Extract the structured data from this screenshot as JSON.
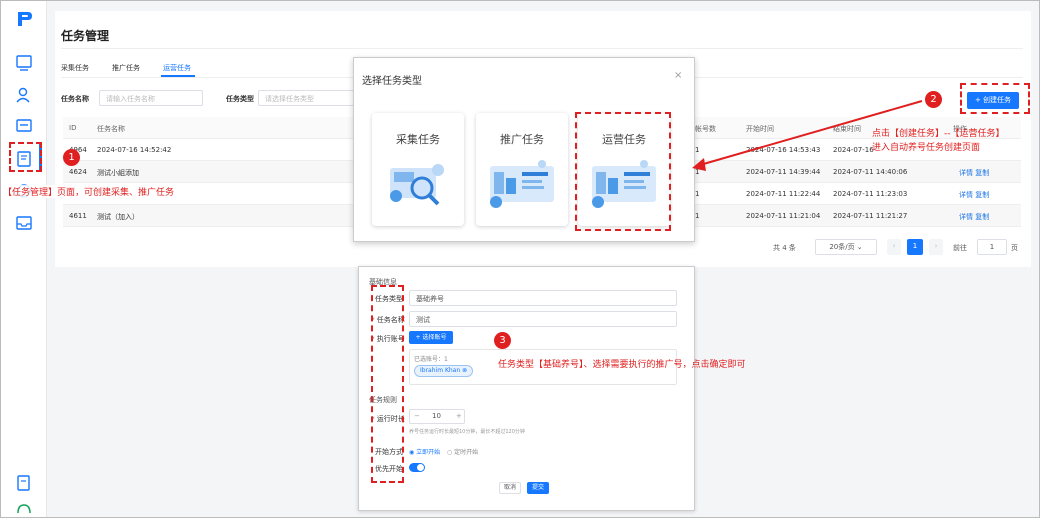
{
  "page": {
    "title": "任务管理"
  },
  "tabs": [
    "采集任务",
    "推广任务",
    "运营任务"
  ],
  "filters": {
    "name_label": "任务名称",
    "name_placeholder": "请输入任务名称",
    "type_label": "任务类型",
    "type_placeholder": "请选择任务类型"
  },
  "create_button": "+ 创建任务",
  "table": {
    "headers": [
      "ID",
      "任务名称",
      "帐号数",
      "开始时间",
      "结束时间",
      "操作"
    ],
    "rows": [
      {
        "id": "4964",
        "name": "2024-07-16 14:52:42",
        "count": "1",
        "start": "2024-07-16 14:53:43",
        "end": "2024-07-16",
        "ops": ""
      },
      {
        "id": "4624",
        "name": "测试小組添加",
        "count": "1",
        "start": "2024-07-11 14:39:44",
        "end": "2024-07-11 14:40:06",
        "ops": "详情 复制"
      },
      {
        "id": "",
        "name": "",
        "count": "1",
        "start": "2024-07-11 11:22:44",
        "end": "2024-07-11 11:23:03",
        "ops": "详情 复制"
      },
      {
        "id": "4611",
        "name": "测试（加入）",
        "count": "1",
        "start": "2024-07-11 11:21:04",
        "end": "2024-07-11 11:21:27",
        "ops": "详情 复制"
      }
    ]
  },
  "pagination": {
    "total": "共 4 条",
    "page_size": "20条/页",
    "current": "1",
    "goto_label": "前往",
    "goto_value": "1",
    "page_suffix": "页"
  },
  "dialog": {
    "title": "选择任务类型",
    "close": "×",
    "types": [
      "采集任务",
      "推广任务",
      "运营任务"
    ]
  },
  "form": {
    "section1": "基础信息",
    "type_label": "任务类型",
    "type_value": "基础养号",
    "name_label": "* 任务名称",
    "name_value": "测试",
    "account_label": "* 执行账号",
    "account_button": "+ 选择账号",
    "selected_text": "已选账号：1",
    "account_tag": "Ibrahim Khan",
    "section2": "任务规则",
    "duration_label": "* 运行时长",
    "duration_value": "10",
    "duration_hint": "养号任务运行时长最短10分钟，最长不超过120分钟",
    "start_label": "开始方式",
    "start_opt1": "立即开始",
    "start_opt2": "定时开始",
    "priority_label": "优先开始",
    "cancel": "取消",
    "submit": "提交"
  },
  "annotations": {
    "n1": "1",
    "n2": "2",
    "n3": "3",
    "note1": "【任务管理】页面，可创建采集、推广任务",
    "note2a": "点击【创建任务】--【运营任务】",
    "note2b": "进入自动养号任务创建页面",
    "note3": "任务类型【基础养号】、选择需要执行的推广号，点击确定即可"
  },
  "colors": {
    "accent": "#1677ff",
    "annotation": "#e02020"
  }
}
